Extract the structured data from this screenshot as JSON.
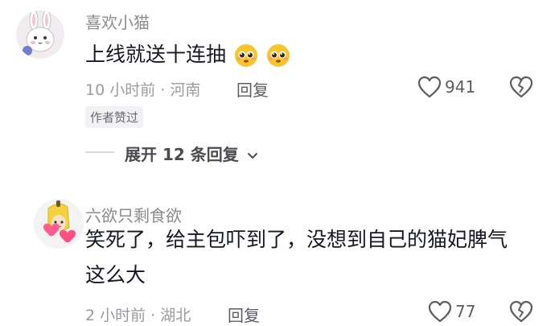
{
  "comments": [
    {
      "username": "喜欢小猫",
      "avatar_icon": "bunny-avatar",
      "text": "上线就送十连抽",
      "emojis": [
        "pleading-face-emoji",
        "pleading-face-emoji"
      ],
      "time_location": "10 小时前 · 河南",
      "reply_label": "回复",
      "like_count": "941",
      "badge": "作者赞过",
      "expand_label": "展开 12 条回复"
    },
    {
      "username": "六欲只剩食欲",
      "avatar_icon": "banana-avatar",
      "text_line1": "笑死了，给主包吓到了，没想到自己的猫妃脾气",
      "text_line2": "这么大",
      "time_location": "2 小时前 · 湖北",
      "reply_label": "回复",
      "like_count": "77"
    }
  ],
  "colors": {
    "text": "#161823",
    "meta": "#9a9ba1",
    "badge_bg": "#f2f2f4",
    "emoji_yellow": "#f9c52b"
  }
}
